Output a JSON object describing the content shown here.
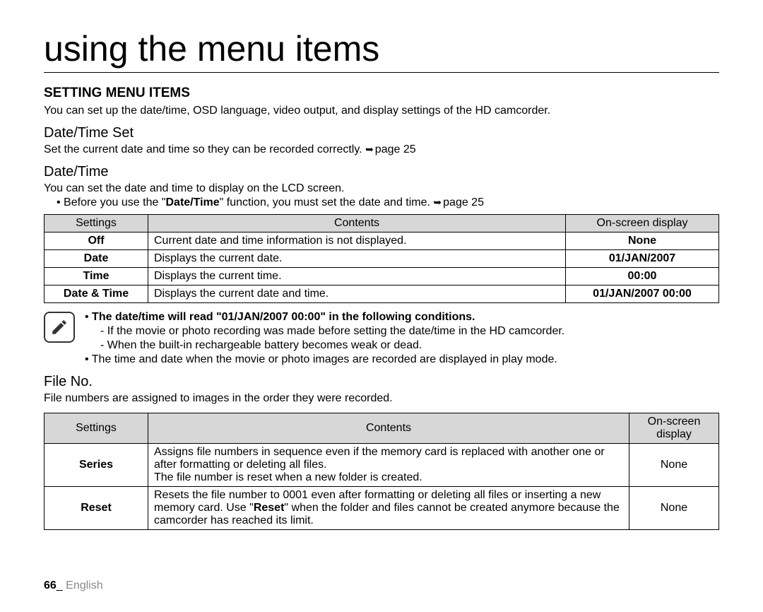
{
  "title": "using the menu items",
  "setting_heading": "SETTING MENU ITEMS",
  "setting_intro": "You can set up the date/time, OSD language, video output, and display settings of the HD camcorder.",
  "datetime_set": {
    "heading": "Date/Time Set",
    "desc_before": "Set the current date and time so they can be recorded correctly. ",
    "desc_ref": "page 25"
  },
  "datetime": {
    "heading": "Date/Time",
    "desc": "You can set the date and time to display on the LCD screen.",
    "bullet_a": "Before you use the \"",
    "bullet_b": "Date/Time",
    "bullet_c": "\" function, you must set the date and time. ",
    "bullet_ref": "page 25"
  },
  "table1": {
    "h1": "Settings",
    "h2": "Contents",
    "h3": "On-screen display",
    "rows": [
      {
        "s": "Off",
        "c": "Current date and time information is not displayed.",
        "d": "None"
      },
      {
        "s": "Date",
        "c": "Displays the current date.",
        "d": "01/JAN/2007"
      },
      {
        "s": "Time",
        "c": "Displays the current time.",
        "d": "00:00"
      },
      {
        "s": "Date & Time",
        "c": "Displays the current date and time.",
        "d": "01/JAN/2007 00:00"
      }
    ]
  },
  "note": {
    "line1": "The date/time will read \"01/JAN/2007 00:00\" in the following conditions.",
    "sub1": "If the movie or photo recording was made before setting the date/time in the HD camcorder.",
    "sub2": "When the built-in rechargeable battery becomes weak or dead.",
    "line2": "The time and date when the movie or photo images are recorded are displayed in play mode."
  },
  "fileno": {
    "heading": "File No.",
    "desc": "File numbers are assigned to images in the order they were recorded."
  },
  "table2": {
    "h1": "Settings",
    "h2": "Contents",
    "h3a": "On-screen",
    "h3b": "display",
    "rows": [
      {
        "s": "Series",
        "c": "Assigns file numbers in sequence even if the memory card is replaced with another one or after formatting or deleting all files.\nThe file number is reset when a new folder is created.",
        "d": "None"
      },
      {
        "s": "Reset",
        "c_a": "Resets the file number to 0001 even after formatting or deleting all files or inserting a new memory card. Use \"",
        "c_b": "Reset",
        "c_c": "\" when the folder and files cannot be created anymore because the camcorder has reached its limit.",
        "d": "None"
      }
    ]
  },
  "footer": {
    "page": "66",
    "sep": "_ ",
    "lang": "English"
  }
}
